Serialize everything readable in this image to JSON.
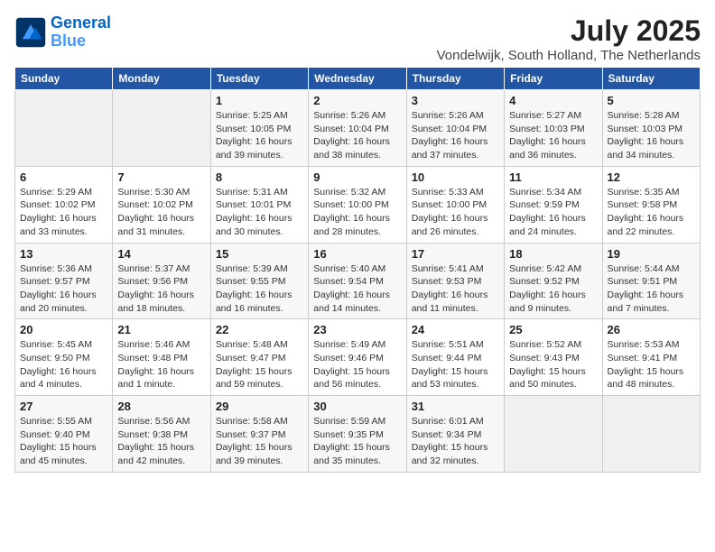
{
  "header": {
    "logo_line1": "General",
    "logo_line2": "Blue",
    "month": "July 2025",
    "location": "Vondelwijk, South Holland, The Netherlands"
  },
  "weekdays": [
    "Sunday",
    "Monday",
    "Tuesday",
    "Wednesday",
    "Thursday",
    "Friday",
    "Saturday"
  ],
  "weeks": [
    [
      {
        "day": "",
        "info": ""
      },
      {
        "day": "",
        "info": ""
      },
      {
        "day": "1",
        "info": "Sunrise: 5:25 AM\nSunset: 10:05 PM\nDaylight: 16 hours\nand 39 minutes."
      },
      {
        "day": "2",
        "info": "Sunrise: 5:26 AM\nSunset: 10:04 PM\nDaylight: 16 hours\nand 38 minutes."
      },
      {
        "day": "3",
        "info": "Sunrise: 5:26 AM\nSunset: 10:04 PM\nDaylight: 16 hours\nand 37 minutes."
      },
      {
        "day": "4",
        "info": "Sunrise: 5:27 AM\nSunset: 10:03 PM\nDaylight: 16 hours\nand 36 minutes."
      },
      {
        "day": "5",
        "info": "Sunrise: 5:28 AM\nSunset: 10:03 PM\nDaylight: 16 hours\nand 34 minutes."
      }
    ],
    [
      {
        "day": "6",
        "info": "Sunrise: 5:29 AM\nSunset: 10:02 PM\nDaylight: 16 hours\nand 33 minutes."
      },
      {
        "day": "7",
        "info": "Sunrise: 5:30 AM\nSunset: 10:02 PM\nDaylight: 16 hours\nand 31 minutes."
      },
      {
        "day": "8",
        "info": "Sunrise: 5:31 AM\nSunset: 10:01 PM\nDaylight: 16 hours\nand 30 minutes."
      },
      {
        "day": "9",
        "info": "Sunrise: 5:32 AM\nSunset: 10:00 PM\nDaylight: 16 hours\nand 28 minutes."
      },
      {
        "day": "10",
        "info": "Sunrise: 5:33 AM\nSunset: 10:00 PM\nDaylight: 16 hours\nand 26 minutes."
      },
      {
        "day": "11",
        "info": "Sunrise: 5:34 AM\nSunset: 9:59 PM\nDaylight: 16 hours\nand 24 minutes."
      },
      {
        "day": "12",
        "info": "Sunrise: 5:35 AM\nSunset: 9:58 PM\nDaylight: 16 hours\nand 22 minutes."
      }
    ],
    [
      {
        "day": "13",
        "info": "Sunrise: 5:36 AM\nSunset: 9:57 PM\nDaylight: 16 hours\nand 20 minutes."
      },
      {
        "day": "14",
        "info": "Sunrise: 5:37 AM\nSunset: 9:56 PM\nDaylight: 16 hours\nand 18 minutes."
      },
      {
        "day": "15",
        "info": "Sunrise: 5:39 AM\nSunset: 9:55 PM\nDaylight: 16 hours\nand 16 minutes."
      },
      {
        "day": "16",
        "info": "Sunrise: 5:40 AM\nSunset: 9:54 PM\nDaylight: 16 hours\nand 14 minutes."
      },
      {
        "day": "17",
        "info": "Sunrise: 5:41 AM\nSunset: 9:53 PM\nDaylight: 16 hours\nand 11 minutes."
      },
      {
        "day": "18",
        "info": "Sunrise: 5:42 AM\nSunset: 9:52 PM\nDaylight: 16 hours\nand 9 minutes."
      },
      {
        "day": "19",
        "info": "Sunrise: 5:44 AM\nSunset: 9:51 PM\nDaylight: 16 hours\nand 7 minutes."
      }
    ],
    [
      {
        "day": "20",
        "info": "Sunrise: 5:45 AM\nSunset: 9:50 PM\nDaylight: 16 hours\nand 4 minutes."
      },
      {
        "day": "21",
        "info": "Sunrise: 5:46 AM\nSunset: 9:48 PM\nDaylight: 16 hours\nand 1 minute."
      },
      {
        "day": "22",
        "info": "Sunrise: 5:48 AM\nSunset: 9:47 PM\nDaylight: 15 hours\nand 59 minutes."
      },
      {
        "day": "23",
        "info": "Sunrise: 5:49 AM\nSunset: 9:46 PM\nDaylight: 15 hours\nand 56 minutes."
      },
      {
        "day": "24",
        "info": "Sunrise: 5:51 AM\nSunset: 9:44 PM\nDaylight: 15 hours\nand 53 minutes."
      },
      {
        "day": "25",
        "info": "Sunrise: 5:52 AM\nSunset: 9:43 PM\nDaylight: 15 hours\nand 50 minutes."
      },
      {
        "day": "26",
        "info": "Sunrise: 5:53 AM\nSunset: 9:41 PM\nDaylight: 15 hours\nand 48 minutes."
      }
    ],
    [
      {
        "day": "27",
        "info": "Sunrise: 5:55 AM\nSunset: 9:40 PM\nDaylight: 15 hours\nand 45 minutes."
      },
      {
        "day": "28",
        "info": "Sunrise: 5:56 AM\nSunset: 9:38 PM\nDaylight: 15 hours\nand 42 minutes."
      },
      {
        "day": "29",
        "info": "Sunrise: 5:58 AM\nSunset: 9:37 PM\nDaylight: 15 hours\nand 39 minutes."
      },
      {
        "day": "30",
        "info": "Sunrise: 5:59 AM\nSunset: 9:35 PM\nDaylight: 15 hours\nand 35 minutes."
      },
      {
        "day": "31",
        "info": "Sunrise: 6:01 AM\nSunset: 9:34 PM\nDaylight: 15 hours\nand 32 minutes."
      },
      {
        "day": "",
        "info": ""
      },
      {
        "day": "",
        "info": ""
      }
    ]
  ]
}
